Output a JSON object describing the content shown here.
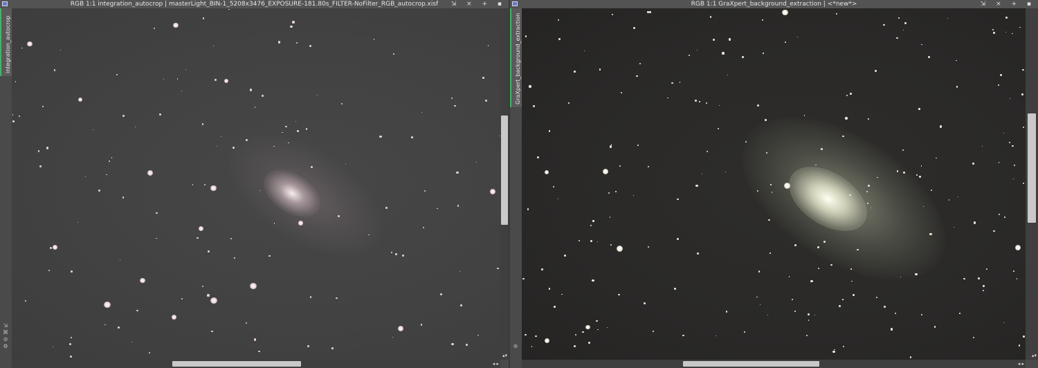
{
  "windows": [
    {
      "id": "left",
      "title": "RGB 1:1 integration_autocrop | masterLight_BIN-1_5208x3476_EXPOSURE-181.80s_FILTER-NoFilter_RGB_autocrop.xisf",
      "tab_label": "integration_autocrop",
      "controls": "⇲ × + ▪"
    },
    {
      "id": "right",
      "title": "RGB 1:1 GraXpert_background_extraction | <*new*>",
      "tab_label": "GraXpert_background_extraction",
      "controls": "⇲ × + ▪"
    }
  ],
  "icons": [
    "window-menu-icon",
    "shrink-icon",
    "close-icon",
    "maximize-icon",
    "minimize-icon",
    "zoom-icon",
    "pan-icon",
    "readout-icon",
    "settings-icon",
    "scroll-arrow-icon"
  ],
  "colors": {
    "titlebar": "#535353",
    "tab_accent": "#46b26a",
    "scroll_thumb": "#c9c9c9"
  }
}
